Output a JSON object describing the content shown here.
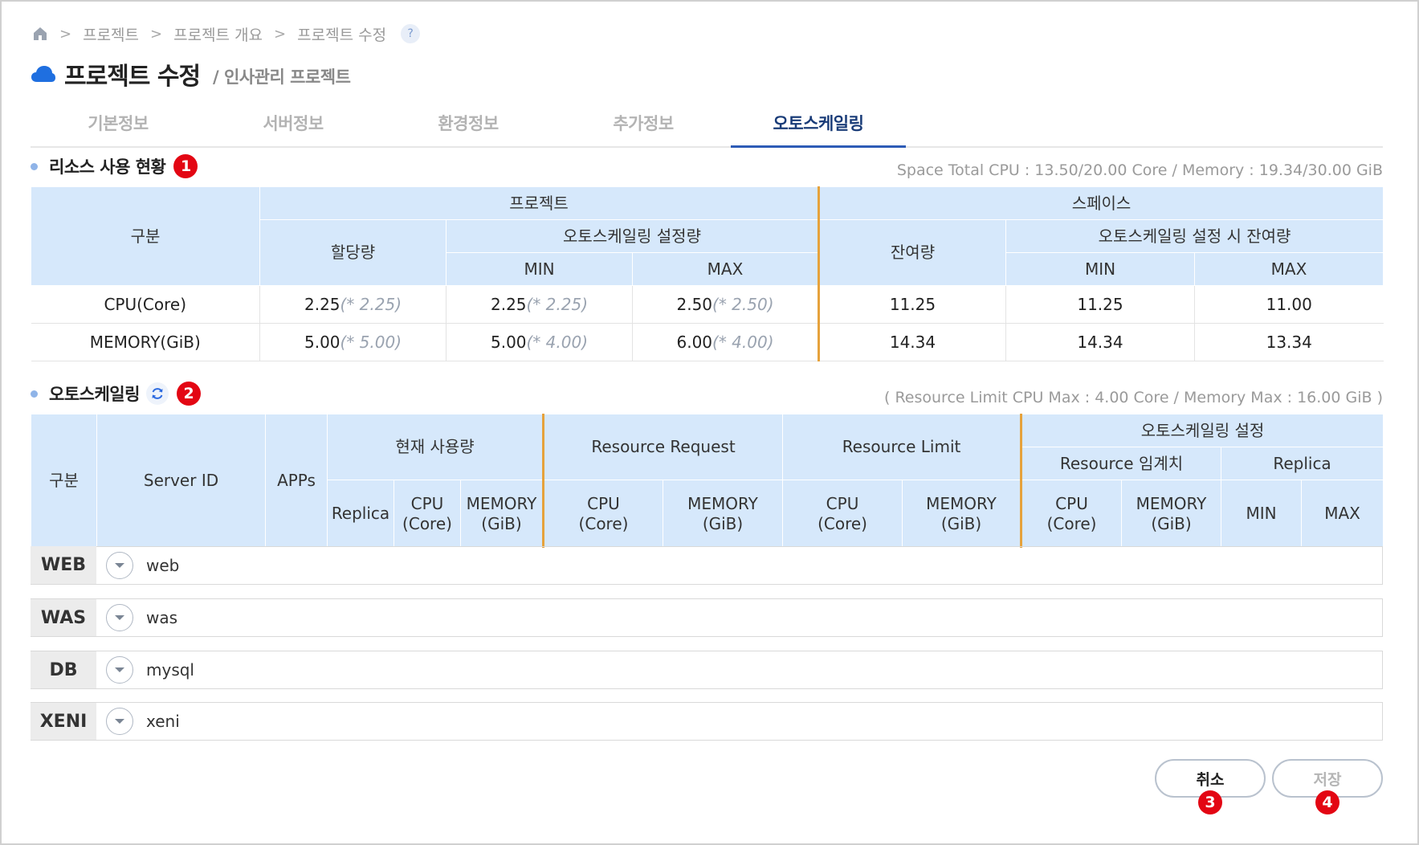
{
  "breadcrumb": {
    "items": [
      "프로젝트",
      "프로젝트 개요",
      "프로젝트 수정"
    ],
    "help": "?"
  },
  "page": {
    "title": "프로젝트 수정",
    "subtitle": "/ 인사관리 프로젝트"
  },
  "tabs": [
    {
      "label": "기본정보"
    },
    {
      "label": "서버정보"
    },
    {
      "label": "환경정보"
    },
    {
      "label": "추가정보"
    },
    {
      "label": "오토스케일링",
      "active": true
    }
  ],
  "resource": {
    "title": "리소스 사용 현황",
    "badge": "1",
    "note": "Space Total CPU : 13.50/20.00 Core / Memory : 19.34/30.00 GiB",
    "headers": {
      "category": "구분",
      "project": "프로젝트",
      "space": "스페이스",
      "allocated": "할당량",
      "as_setting": "오토스케일링 설정량",
      "remaining": "잔여량",
      "as_remaining": "오토스케일링 설정 시 잔여량",
      "min": "MIN",
      "max": "MAX"
    },
    "rows": [
      {
        "label": "CPU(Core)",
        "alloc": "2.25",
        "alloc_sub": "(* 2.25)",
        "min": "2.25",
        "min_sub": "(* 2.25)",
        "max": "2.50",
        "max_sub": "(* 2.50)",
        "remain": "11.25",
        "as_min": "11.25",
        "as_max": "11.00"
      },
      {
        "label": "MEMORY(GiB)",
        "alloc": "5.00",
        "alloc_sub": "(* 5.00)",
        "min": "5.00",
        "min_sub": "(* 4.00)",
        "max": "6.00",
        "max_sub": "(* 4.00)",
        "remain": "14.34",
        "as_min": "14.34",
        "as_max": "13.34"
      }
    ]
  },
  "autoscaling": {
    "title": "오토스케일링",
    "badge": "2",
    "note": "( Resource Limit CPU Max : 4.00 Core / Memory Max : 16.00 GiB )",
    "headers": {
      "category": "구분",
      "server_id": "Server ID",
      "apps": "APPs",
      "current_usage": "현재 사용량",
      "resource_request": "Resource Request",
      "resource_limit": "Resource Limit",
      "as_setting": "오토스케일링 설정",
      "resource_threshold": "Resource 임계치",
      "replica_group": "Replica",
      "replica": "Replica",
      "cpu_l1": "CPU",
      "cpu_l2": "(Core)",
      "mem_l1": "MEMORY",
      "mem_l2": "(GiB)",
      "min": "MIN",
      "max": "MAX"
    },
    "groups": [
      {
        "label": "WEB",
        "server": "web"
      },
      {
        "label": "WAS",
        "server": "was"
      },
      {
        "label": "DB",
        "server": "mysql"
      },
      {
        "label": "XENI",
        "server": "xeni"
      }
    ]
  },
  "buttons": {
    "cancel": "취소",
    "save": "저장",
    "cancel_badge": "3",
    "save_badge": "4"
  },
  "colors": {
    "accent": "#2d5bb6",
    "header_bg": "#d6e8fb",
    "divider": "#e6a23c",
    "badge": "#e30613"
  }
}
